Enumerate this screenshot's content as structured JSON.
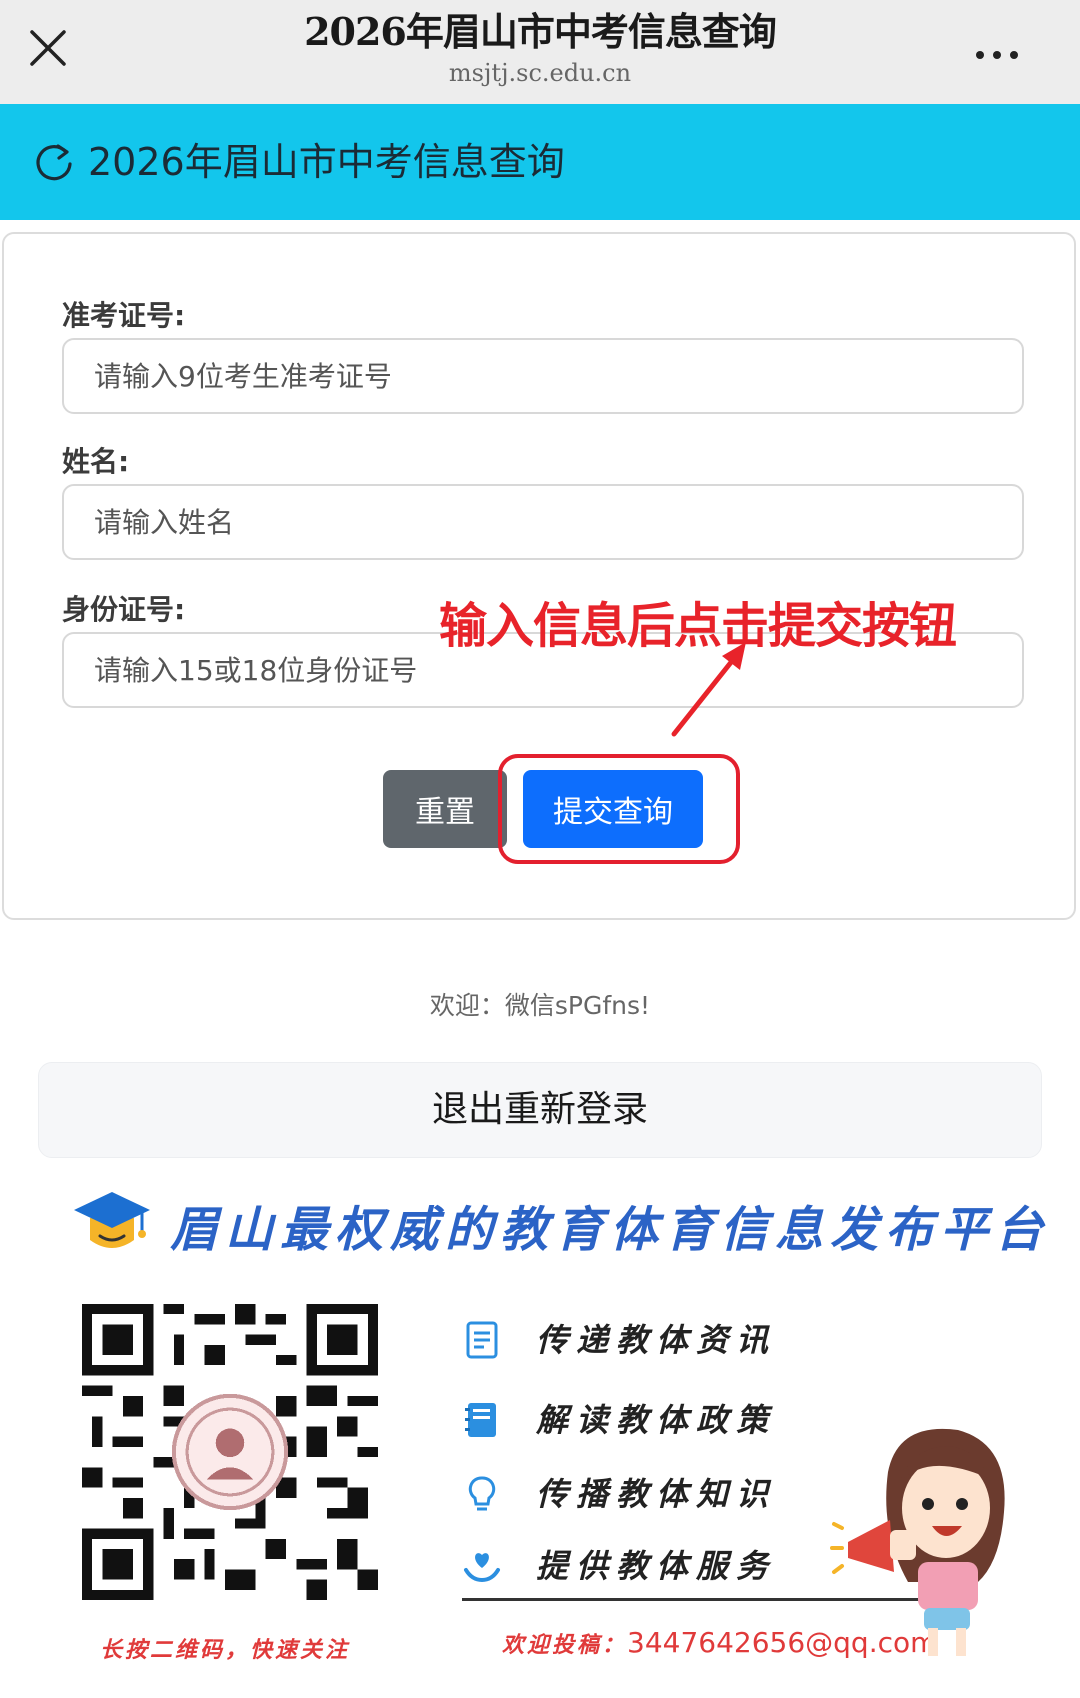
{
  "topbar": {
    "title": "2026年眉山市中考信息查询",
    "url": "msjtj.sc.edu.cn",
    "close_icon": "close-icon",
    "more_icon": "more-dots-icon"
  },
  "header": {
    "icon": "refresh-icon",
    "title": "2026年眉山市中考信息查询",
    "color": "#13c6ec"
  },
  "form": {
    "exam_id": {
      "label": "准考证号:",
      "placeholder": "请输入9位考生准考证号",
      "value": ""
    },
    "name": {
      "label": "姓名:",
      "placeholder": "请输入姓名",
      "value": ""
    },
    "id_card": {
      "label": "身份证号:",
      "placeholder": "请输入15或18位身份证号",
      "value": ""
    },
    "annotation": "输入信息后点击提交按钮",
    "reset_label": "重置",
    "submit_label": "提交查询"
  },
  "welcome": "欢迎：微信sPGfns!",
  "logout_label": "退出重新登录",
  "promo": {
    "slogan": "眉山最权威的教育体育信息发布平台",
    "qr_caption": "长按二维码，快速关注",
    "features": [
      {
        "icon": "document-icon",
        "text": "传递教体资讯"
      },
      {
        "icon": "book-icon",
        "text": "解读教体政策"
      },
      {
        "icon": "lightbulb-icon",
        "text": "传播教体知识"
      },
      {
        "icon": "heart-hand-icon",
        "text": "提供教体服务"
      }
    ],
    "contact_label": "欢迎投稿：",
    "contact_email": "3447642656@qq.com"
  },
  "colors": {
    "accent": "#13c6ec",
    "submit": "#0d6efd",
    "reset": "#5f666c",
    "annotation": "#e8232a"
  }
}
